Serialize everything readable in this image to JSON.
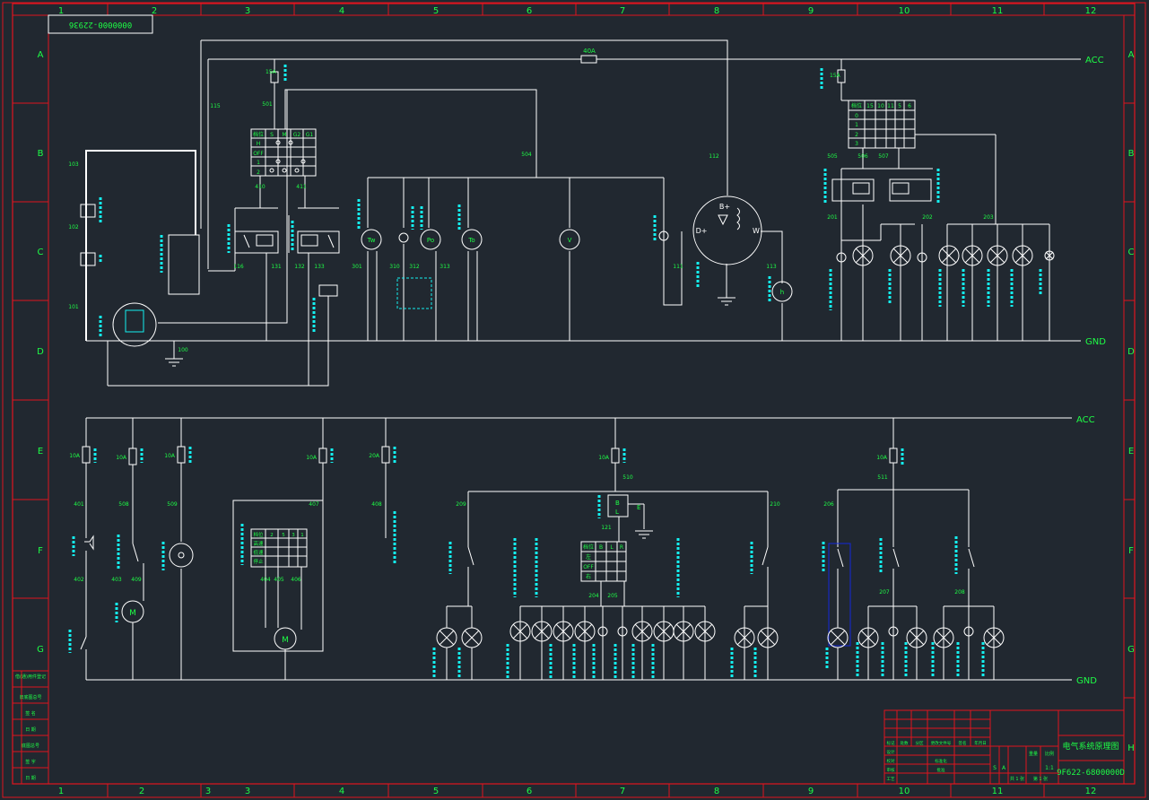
{
  "drawing_number_box": "0000000-22936",
  "column_numbers": [
    "1",
    "2",
    "3",
    "4",
    "5",
    "6",
    "7",
    "8",
    "9",
    "10",
    "11",
    "12"
  ],
  "row_letters": [
    "A",
    "B",
    "C",
    "D",
    "E",
    "F",
    "G",
    "H"
  ],
  "rails": {
    "acc_top": "ACC",
    "gnd_top": "GND",
    "acc_bottom": "ACC",
    "gnd_bottom": "GND"
  },
  "wire_numbers": {
    "w103": "103",
    "w102": "102",
    "w101": "101",
    "w100": "100",
    "w115": "115",
    "w501": "501",
    "w410": "410",
    "w411": "411",
    "w116": "116",
    "w131": "131",
    "w132": "132",
    "w133": "133",
    "w504": "504",
    "w301": "301",
    "w310": "310",
    "w312": "312",
    "w313": "313",
    "w111": "111",
    "w112": "112",
    "w113": "113",
    "w505": "505",
    "w506": "506",
    "w507": "507",
    "w201": "201",
    "w202": "202",
    "w203": "203",
    "w401": "401",
    "w402": "402",
    "w508": "508",
    "w403": "403",
    "w409": "409",
    "w509": "509",
    "w404": "404",
    "w405": "405",
    "w406": "406",
    "w407": "407",
    "w408": "408",
    "w209": "209",
    "w510": "510",
    "w121": "121",
    "w204": "204",
    "w205": "205",
    "w210": "210",
    "w511": "511",
    "w206": "206",
    "w207": "207",
    "w208": "208"
  },
  "fuses": {
    "main": "40A",
    "f15a_top": "15A",
    "f10a_top": "10A",
    "e1": "10A",
    "e2": "10A",
    "e3": "10A",
    "e4": "10A",
    "e5": "20A",
    "e6": "10A",
    "e7": "10A"
  },
  "gauges": {
    "tw": "Tw",
    "po": "Po",
    "to": "To",
    "v": "V",
    "h": "h"
  },
  "alternator": {
    "bplus": "B+",
    "dplus": "D+",
    "w": "W"
  },
  "ignition_switch": {
    "header": [
      "档位",
      "S",
      "M",
      "G2",
      "G1"
    ],
    "rows": [
      "H",
      "OFF",
      "1",
      "2"
    ]
  },
  "light_switch": {
    "header": [
      "档位",
      "15",
      "10",
      "11",
      "5",
      "6"
    ],
    "rows": [
      "0",
      "1",
      "2",
      "3"
    ]
  },
  "wiper_switch": {
    "header": [
      "档位",
      "2",
      "5",
      "3",
      "1"
    ],
    "rows": [
      "高速",
      "低速",
      "停止",
      "间歇"
    ]
  },
  "turn_switch": {
    "header": [
      "档位",
      "B",
      "L",
      "R"
    ],
    "rows": [
      "左",
      "OFF",
      "右"
    ]
  },
  "relay_121": {
    "b": "B",
    "l": "L",
    "e": "E"
  },
  "title_block": {
    "title": "电气系统原理图",
    "code": "9F622-6800000D",
    "scale_label": "比例",
    "weight_label": "重量",
    "scale": "1:1",
    "sheet": "共 1 张",
    "page": "第 1 张",
    "stage": "S",
    "stage2": "A",
    "row_labels": [
      "设计",
      "校对",
      "审核",
      "工艺",
      "标准化",
      "批准"
    ],
    "change_headers": [
      "标记",
      "处数",
      "分区",
      "更改文件号",
      "签名",
      "年月日"
    ]
  },
  "left_stamp": [
    "借(通)用件登记",
    "旧底图总号",
    "签 名",
    "日 期",
    "底图总号",
    "签 字",
    "日 期"
  ],
  "colors": {
    "background": "#212830",
    "frame": "#e0141e",
    "wire": "#ffffff",
    "text": "#1eff46",
    "component": "#14f0f0",
    "highlight": "#1428dc"
  }
}
